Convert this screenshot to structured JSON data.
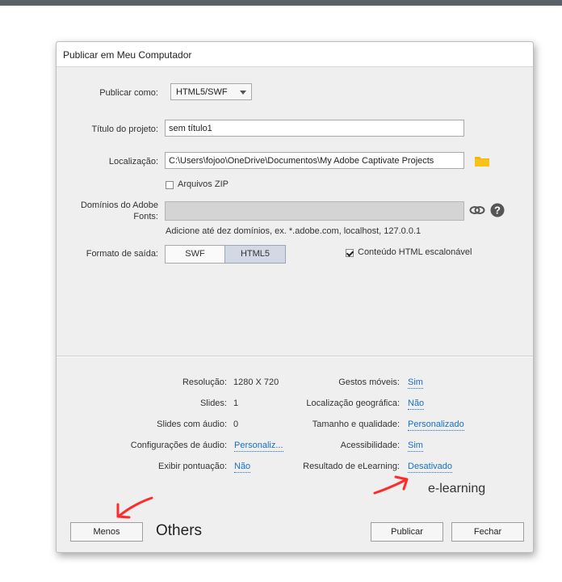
{
  "dialog": {
    "title": "Publicar em Meu Computador"
  },
  "form": {
    "publish_as_label": "Publicar como:",
    "publish_as_value": "HTML5/SWF",
    "project_title_label": "Título do projeto:",
    "project_title_value": "sem título1",
    "location_label": "Localização:",
    "location_value": "C:\\Users\\fojoo\\OneDrive\\Documentos\\My Adobe Captivate Projects",
    "zip_label": "Arquivos ZIP",
    "zip_checked": false,
    "fonts_label_line1": "Domínios do Adobe",
    "fonts_label_line2": "Fonts:",
    "fonts_value": "",
    "fonts_hint": "Adicione até dez domínios, ex. *.adobe.com, localhost, 127.0.0.1",
    "output_label": "Formato de saída:",
    "output_swf": "SWF",
    "output_html5": "HTML5",
    "output_selected": "HTML5",
    "scalable_label": "Conteúdo HTML escalonável",
    "scalable_checked": true
  },
  "info": {
    "resolution_label": "Resolução:",
    "resolution_value": "1280 X 720",
    "slides_label": "Slides:",
    "slides_value": "1",
    "audio_slides_label": "Slides com áudio:",
    "audio_slides_value": "0",
    "audio_config_label": "Configurações de áudio:",
    "audio_config_value": "Personaliz...",
    "score_label": "Exibir pontuação:",
    "score_value": "Não",
    "gestures_label": "Gestos móveis:",
    "gestures_value": "Sim",
    "geo_label": "Localização geográfica:",
    "geo_value": "Não",
    "size_label": "Tamanho e qualidade:",
    "size_value": "Personalizado",
    "access_label": "Acessibilidade:",
    "access_value": "Sim",
    "elearning_label": "Resultado de eLearning:",
    "elearning_value": "Desativado"
  },
  "buttons": {
    "less": "Menos",
    "publish": "Publicar",
    "close": "Fechar"
  },
  "annotations": {
    "others": "Others",
    "elearning": "e-learning",
    "arrow_color": "#ff2a2a"
  },
  "icons": {
    "folder": "folder-icon",
    "link": "link-icon",
    "help": "help-icon"
  },
  "colors": {
    "link": "#1a6fc4",
    "folder": "#f5b800",
    "selected_segment": "#d2d9e4"
  }
}
